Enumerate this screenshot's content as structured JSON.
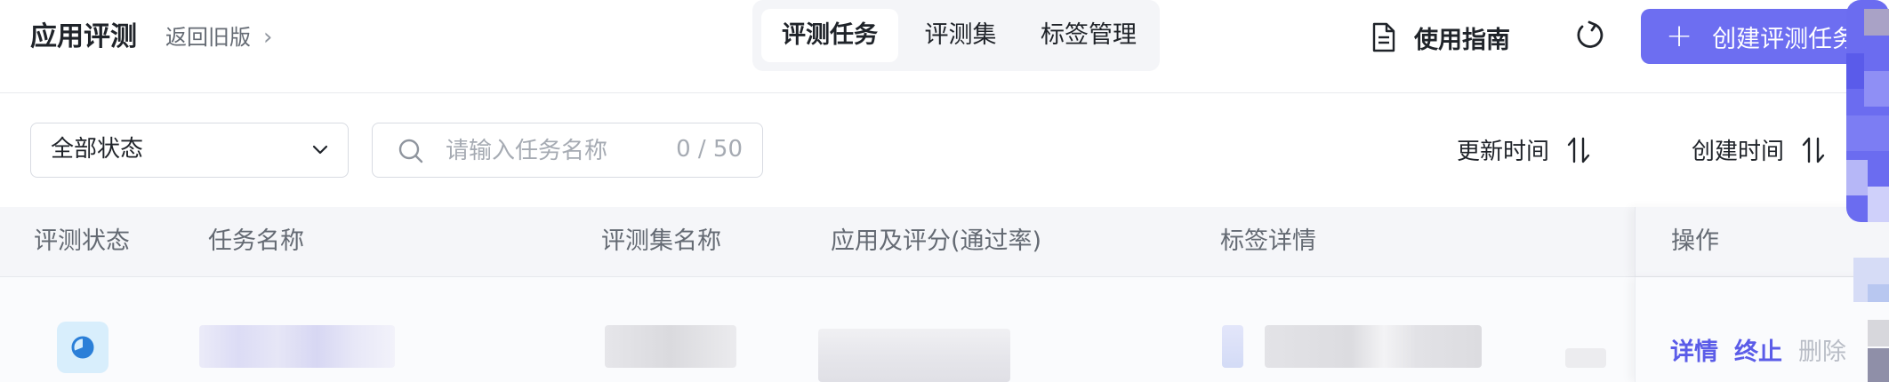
{
  "header": {
    "app_title": "应用评测",
    "back_link": "返回旧版",
    "tabs": [
      {
        "label": "评测任务",
        "active": true
      },
      {
        "label": "评测集",
        "active": false
      },
      {
        "label": "标签管理",
        "active": false
      }
    ],
    "guide_label": "使用指南",
    "create_button": "创建评测任务"
  },
  "filters": {
    "status_select": "全部状态",
    "search_placeholder": "请输入任务名称",
    "search_counter": "0 / 50",
    "sort_updated": "更新时间",
    "sort_created": "创建时间"
  },
  "table": {
    "columns": [
      "评测状态",
      "任务名称",
      "评测集名称",
      "应用及评分(通过率)",
      "标签详情",
      "操作"
    ],
    "row_actions": {
      "detail": "详情",
      "stop": "终止",
      "delete": "删除"
    }
  },
  "colors": {
    "accent": "#6d6ef1",
    "link": "#5b5ce8",
    "disabled": "#b9bdc6"
  }
}
